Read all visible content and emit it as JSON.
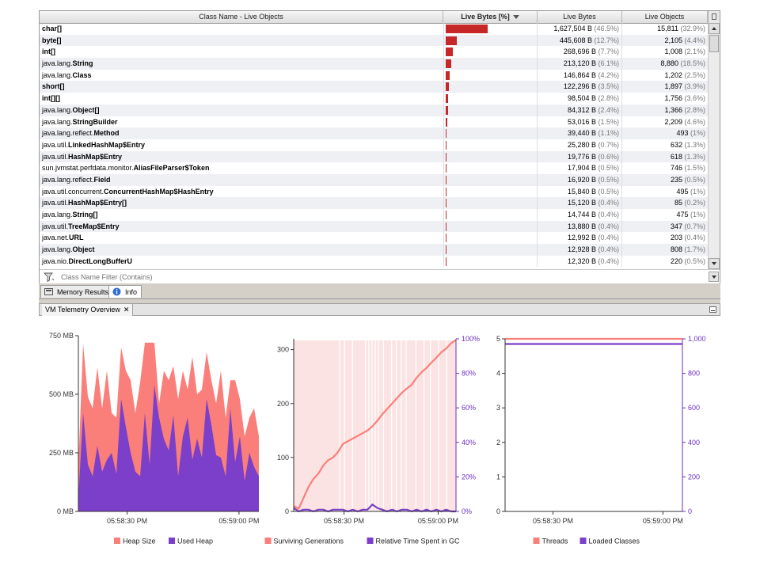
{
  "table": {
    "columns": [
      "Class Name - Live Objects",
      "Live Bytes [%]",
      "Live Bytes",
      "Live Objects"
    ],
    "sorted_column": 1,
    "rows": [
      {
        "pkg": "",
        "cls": "char[]",
        "bytes": "1,627,504 B",
        "bytes_pct": "(46.5%)",
        "objects": "15,811",
        "objects_pct": "(32.9%)",
        "share": 46.5
      },
      {
        "pkg": "",
        "cls": "byte[]",
        "bytes": "445,608 B",
        "bytes_pct": "(12.7%)",
        "objects": "2,105",
        "objects_pct": "(4.4%)",
        "share": 12.7
      },
      {
        "pkg": "",
        "cls": "int[]",
        "bytes": "268,696 B",
        "bytes_pct": "(7.7%)",
        "objects": "1,008",
        "objects_pct": "(2.1%)",
        "share": 7.7
      },
      {
        "pkg": "java.lang.",
        "cls": "String",
        "bytes": "213,120 B",
        "bytes_pct": "(6.1%)",
        "objects": "8,880",
        "objects_pct": "(18.5%)",
        "share": 6.1
      },
      {
        "pkg": "java.lang.",
        "cls": "Class",
        "bytes": "146,864 B",
        "bytes_pct": "(4.2%)",
        "objects": "1,202",
        "objects_pct": "(2.5%)",
        "share": 4.2
      },
      {
        "pkg": "",
        "cls": "short[]",
        "bytes": "122,296 B",
        "bytes_pct": "(3.5%)",
        "objects": "1,897",
        "objects_pct": "(3.9%)",
        "share": 3.5
      },
      {
        "pkg": "",
        "cls": "int[][]",
        "bytes": "98,504 B",
        "bytes_pct": "(2.8%)",
        "objects": "1,756",
        "objects_pct": "(3.6%)",
        "share": 2.8
      },
      {
        "pkg": "java.lang.",
        "cls": "Object[]",
        "bytes": "84,312 B",
        "bytes_pct": "(2.4%)",
        "objects": "1,366",
        "objects_pct": "(2.8%)",
        "share": 2.4
      },
      {
        "pkg": "java.lang.",
        "cls": "StringBuilder",
        "bytes": "53,016 B",
        "bytes_pct": "(1.5%)",
        "objects": "2,209",
        "objects_pct": "(4.6%)",
        "share": 1.5
      },
      {
        "pkg": "java.lang.reflect.",
        "cls": "Method",
        "bytes": "39,440 B",
        "bytes_pct": "(1.1%)",
        "objects": "493",
        "objects_pct": "(1%)",
        "share": 1.1
      },
      {
        "pkg": "java.util.",
        "cls": "LinkedHashMap$Entry",
        "bytes": "25,280 B",
        "bytes_pct": "(0.7%)",
        "objects": "632",
        "objects_pct": "(1.3%)",
        "share": 0.7
      },
      {
        "pkg": "java.util.",
        "cls": "HashMap$Entry",
        "bytes": "19,776 B",
        "bytes_pct": "(0.6%)",
        "objects": "618",
        "objects_pct": "(1.3%)",
        "share": 0.6
      },
      {
        "pkg": "sun.jvmstat.perfdata.monitor.",
        "cls": "AliasFileParser$Token",
        "bytes": "17,904 B",
        "bytes_pct": "(0.5%)",
        "objects": "746",
        "objects_pct": "(1.5%)",
        "share": 0.5
      },
      {
        "pkg": "java.lang.reflect.",
        "cls": "Field",
        "bytes": "16,920 B",
        "bytes_pct": "(0.5%)",
        "objects": "235",
        "objects_pct": "(0.5%)",
        "share": 0.5
      },
      {
        "pkg": "java.util.concurrent.",
        "cls": "ConcurrentHashMap$HashEntry",
        "bytes": "15,840 B",
        "bytes_pct": "(0.5%)",
        "objects": "495",
        "objects_pct": "(1%)",
        "share": 0.5
      },
      {
        "pkg": "java.util.",
        "cls": "HashMap$Entry[]",
        "bytes": "15,120 B",
        "bytes_pct": "(0.4%)",
        "objects": "85",
        "objects_pct": "(0.2%)",
        "share": 0.4
      },
      {
        "pkg": "java.lang.",
        "cls": "String[]",
        "bytes": "14,744 B",
        "bytes_pct": "(0.4%)",
        "objects": "475",
        "objects_pct": "(1%)",
        "share": 0.4
      },
      {
        "pkg": "java.util.",
        "cls": "TreeMap$Entry",
        "bytes": "13,880 B",
        "bytes_pct": "(0.4%)",
        "objects": "347",
        "objects_pct": "(0.7%)",
        "share": 0.4
      },
      {
        "pkg": "java.net.",
        "cls": "URL",
        "bytes": "12,992 B",
        "bytes_pct": "(0.4%)",
        "objects": "203",
        "objects_pct": "(0.4%)",
        "share": 0.4
      },
      {
        "pkg": "java.lang.",
        "cls": "Object",
        "bytes": "12,928 B",
        "bytes_pct": "(0.4%)",
        "objects": "808",
        "objects_pct": "(1.7%)",
        "share": 0.4
      },
      {
        "pkg": "java.nio.",
        "cls": "DirectLongBufferU",
        "bytes": "12,320 B",
        "bytes_pct": "(0.4%)",
        "objects": "220",
        "objects_pct": "(0.5%)",
        "share": 0.4
      }
    ],
    "filter": {
      "placeholder": "Class Name Filter (Contains)",
      "value": ""
    },
    "icons": {
      "filter": "filter-funnel-icon",
      "scroll_up": "arrow-up-icon",
      "scroll_down": "arrow-down-icon",
      "corner": "column-chooser-icon"
    }
  },
  "tabs": [
    {
      "label": "Memory Results",
      "icon": "memory-results-icon"
    },
    {
      "label": "Info",
      "icon": "info-icon"
    }
  ],
  "telemetry": {
    "tab_label": "VM Telemetry Overview",
    "close_glyph": "✕",
    "minimize_icon": "minimize-icon"
  },
  "colors": {
    "bar": "#c62828",
    "salmon": "#fa7f7a",
    "purple": "#7b3fc9",
    "purple_dark": "#6a2fbf",
    "pink_bg": "#fbe3e3"
  },
  "chart_data": [
    {
      "type": "area",
      "x_ticks": [
        "05:58:30 PM",
        "05:59:00 PM"
      ],
      "y_ticks": [
        "0 MB",
        "250 MB",
        "500 MB",
        "750 MB"
      ],
      "ylim": [
        0,
        750
      ],
      "legend": [
        "Heap Size",
        "Used Heap"
      ],
      "legend_position": "bottom",
      "series": [
        {
          "name": "Heap Size",
          "color": "#fa7f7a",
          "values": [
            200,
            715,
            490,
            440,
            615,
            440,
            600,
            420,
            400,
            700,
            600,
            560,
            420,
            550,
            720,
            720,
            720,
            460,
            600,
            560,
            620,
            480,
            600,
            520,
            660,
            500,
            520,
            680,
            560,
            460,
            600,
            400,
            560,
            560,
            480,
            320,
            400,
            440,
            320
          ]
        },
        {
          "name": "Used Heap",
          "color": "#7b3fc9",
          "values": [
            60,
            420,
            200,
            150,
            280,
            170,
            220,
            250,
            160,
            480,
            360,
            250,
            170,
            150,
            420,
            200,
            540,
            400,
            310,
            260,
            410,
            150,
            320,
            400,
            220,
            310,
            230,
            480,
            370,
            240,
            230,
            150,
            440,
            210,
            320,
            130,
            250,
            190,
            150
          ]
        }
      ]
    },
    {
      "type": "line",
      "x_ticks": [
        "05:58:30 PM",
        "05:59:00 PM"
      ],
      "y_ticks": [
        "0",
        "100",
        "200",
        "300"
      ],
      "y2_ticks": [
        "0%",
        "20%",
        "40%",
        "60%",
        "80%",
        "100%"
      ],
      "ylim": [
        0,
        320
      ],
      "y2lim": [
        0,
        100
      ],
      "legend": [
        "Surviving Generations",
        "Relative Time Spent in GC"
      ],
      "legend_position": "bottom",
      "series": [
        {
          "name": "Surviving Generations",
          "color": "#fa7f7a",
          "values": [
            10,
            5,
            25,
            45,
            60,
            70,
            85,
            95,
            100,
            110,
            125,
            130,
            135,
            140,
            145,
            150,
            158,
            168,
            180,
            190,
            200,
            210,
            220,
            228,
            235,
            248,
            258,
            266,
            276,
            285,
            295,
            302,
            312,
            318
          ]
        },
        {
          "name": "Relative Time Spent in GC",
          "color": "#7b3fc9",
          "axis": "right",
          "values": [
            2,
            0,
            1,
            1,
            0,
            1,
            1,
            0,
            1,
            1,
            1,
            0,
            1,
            0,
            1,
            1,
            4,
            2,
            1,
            0,
            1,
            0,
            1,
            1,
            0,
            1,
            0,
            1,
            0,
            1,
            0,
            1,
            0,
            0
          ]
        }
      ]
    },
    {
      "type": "line",
      "x_ticks": [
        "05:58:30 PM",
        "05:59:00 PM"
      ],
      "y_ticks": [
        "0",
        "1",
        "2",
        "3",
        "4",
        "5"
      ],
      "y2_ticks": [
        "0",
        "200",
        "400",
        "600",
        "800",
        "1,000"
      ],
      "ylim": [
        0,
        5
      ],
      "y2lim": [
        0,
        1000
      ],
      "legend": [
        "Threads",
        "Loaded Classes"
      ],
      "legend_position": "bottom",
      "series": [
        {
          "name": "Threads",
          "color": "#fa7f7a",
          "values": [
            5,
            5
          ]
        },
        {
          "name": "Loaded Classes",
          "color": "#7b3fc9",
          "axis": "right",
          "values": [
            970,
            970
          ]
        }
      ]
    }
  ]
}
